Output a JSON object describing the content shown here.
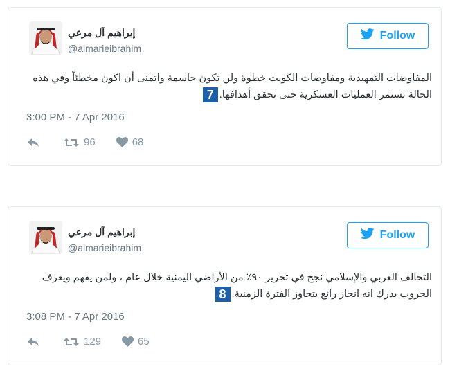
{
  "tweets": [
    {
      "author_name": "إبراهيم آل مرعي",
      "handle": "@almarieibrahim",
      "follow_label": "Follow",
      "text_before": "المفاوضات التمهيدية ومفاوضات الكويت خطوة ولن تكون حاسمة واتمنى أن اكون مخطئاً وفي هذه الحالة تستمر العمليات العسكرية حتى تحقق أهدافها.",
      "badge": "7",
      "text_after": "",
      "timestamp": "3:00 PM - 7 Apr 2016",
      "retweets": "96",
      "likes": "68"
    },
    {
      "author_name": "إبراهيم آل مرعي",
      "handle": "@almarieibrahim",
      "follow_label": "Follow",
      "text_before": "التحالف العربي والإسلامي نجح في تحرير ٩٠٪ من الأراضي اليمنية خلال عام ، ولمن يفهم ويعرف الحروب يدرك انه انجاز رائع يتجاوز الفترة الزمنية.",
      "badge": "8",
      "text_after": "",
      "timestamp": "3:08 PM - 7 Apr 2016",
      "retweets": "129",
      "likes": "65"
    }
  ],
  "colors": {
    "accent": "#1da1f2",
    "badge": "#1d5fa8",
    "muted": "#8899a6",
    "text": "#292f33"
  },
  "icons": [
    "twitter-bird-icon",
    "reply-icon",
    "retweet-icon",
    "heart-icon"
  ]
}
